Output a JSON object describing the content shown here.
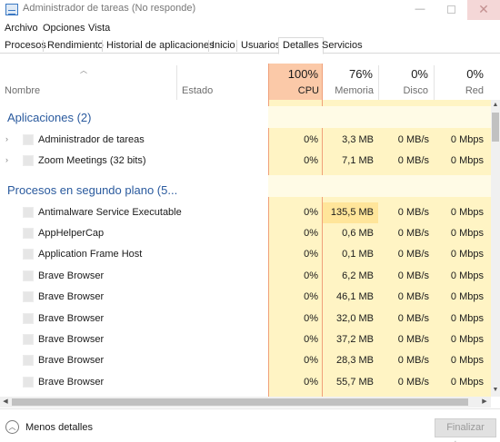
{
  "window": {
    "title": "Administrador de tareas (No responde)",
    "minimize": "—",
    "close": "✕"
  },
  "menu": [
    "Archivo",
    "Opciones",
    "Vista"
  ],
  "tabs": [
    "Procesos",
    "Rendimiento",
    "Historial de aplicaciones",
    "Inicio",
    "Usuarios",
    "Detalles",
    "Servicios"
  ],
  "active_tab": "Detalles",
  "columns": {
    "name": "Nombre",
    "status": "Estado",
    "cpu": {
      "pct": "100%",
      "label": "CPU"
    },
    "memory": {
      "pct": "76%",
      "label": "Memoria"
    },
    "disk": {
      "pct": "0%",
      "label": "Disco"
    },
    "network": {
      "pct": "0%",
      "label": "Red"
    }
  },
  "groups": {
    "apps": {
      "title": "Aplicaciones (2)",
      "rows": [
        {
          "name": "Administrador de tareas",
          "cpu": "0%",
          "mem": "3,3 MB",
          "disk": "0 MB/s",
          "net": "0 Mbps"
        },
        {
          "name": "Zoom Meetings (32 bits)",
          "cpu": "0%",
          "mem": "7,1 MB",
          "disk": "0 MB/s",
          "net": "0 Mbps"
        }
      ]
    },
    "background": {
      "title": "Procesos en segundo plano (5...",
      "rows": [
        {
          "name": "Antimalware Service Executable",
          "cpu": "0%",
          "mem": "135,5 MB",
          "disk": "0 MB/s",
          "net": "0 Mbps"
        },
        {
          "name": "AppHelperCap",
          "cpu": "0%",
          "mem": "0,6 MB",
          "disk": "0 MB/s",
          "net": "0 Mbps"
        },
        {
          "name": "Application Frame Host",
          "cpu": "0%",
          "mem": "0,1 MB",
          "disk": "0 MB/s",
          "net": "0 Mbps"
        },
        {
          "name": "Brave Browser",
          "cpu": "0%",
          "mem": "6,2 MB",
          "disk": "0 MB/s",
          "net": "0 Mbps"
        },
        {
          "name": "Brave Browser",
          "cpu": "0%",
          "mem": "46,1 MB",
          "disk": "0 MB/s",
          "net": "0 Mbps"
        },
        {
          "name": "Brave Browser",
          "cpu": "0%",
          "mem": "32,0 MB",
          "disk": "0 MB/s",
          "net": "0 Mbps"
        },
        {
          "name": "Brave Browser",
          "cpu": "0%",
          "mem": "37,2 MB",
          "disk": "0 MB/s",
          "net": "0 Mbps"
        },
        {
          "name": "Brave Browser",
          "cpu": "0%",
          "mem": "28,3 MB",
          "disk": "0 MB/s",
          "net": "0 Mbps"
        },
        {
          "name": "Brave Browser",
          "cpu": "0%",
          "mem": "55,7 MB",
          "disk": "0 MB/s",
          "net": "0 Mbps"
        }
      ]
    }
  },
  "footer": {
    "less_details": "Menos detalles",
    "end_task": "Finalizar tarea"
  },
  "colors": {
    "cpu_header": "#fbc9a8",
    "heat_light": "#fff4c4",
    "heat_medium": "#ffe59a",
    "group_title": "#2a5a9e"
  }
}
